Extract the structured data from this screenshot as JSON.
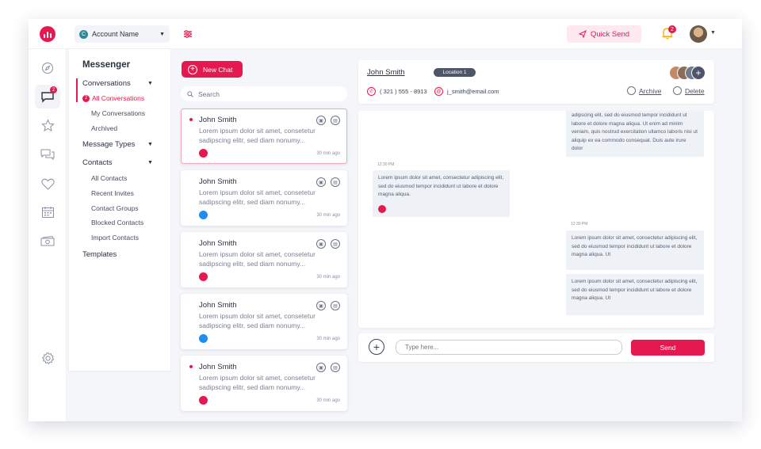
{
  "colors": {
    "brand": "#e5194f",
    "messenger": "#1f8ef1",
    "location_badge": "#4d5668"
  },
  "topbar": {
    "account_initial": "C",
    "account_name": "Account Name",
    "quick_send_label": "Quick Send",
    "notification_count": "2"
  },
  "rail": {
    "icons": [
      "compass-icon",
      "chat-icon",
      "star-icon",
      "comments-icon",
      "heart-icon",
      "calendar-icon",
      "money-icon",
      "settings-icon"
    ],
    "chat_badge": "2"
  },
  "nav": {
    "title": "Messenger",
    "conversations": "Conversations",
    "all_conversations": "All Conversations",
    "all_conversations_badge": "2",
    "my_conversations": "My Conversations",
    "archived": "Archived",
    "message_types": "Message Types",
    "contacts": "Contacts",
    "all_contacts": "All Contacts",
    "recent_invites": "Recent Invites",
    "contact_groups": "Contact Groups",
    "blocked_contacts": "Blocked Contacts",
    "import_contacts": "Import Contacts",
    "templates": "Templates"
  },
  "list": {
    "new_chat_label": "New Chat",
    "search_placeholder": "Search",
    "cards": [
      {
        "name": "John Smith",
        "preview": "Lorem ipsum dolor sit amet, consetetur sadipscing elitr, sed diam nonumy...",
        "time": "30 min ago",
        "channel": "sms",
        "unread": true,
        "active": true
      },
      {
        "name": "John Smith",
        "preview": "Lorem ipsum dolor sit amet, consetetur sadipscing elitr, sed diam nonumy...",
        "time": "30 min ago",
        "channel": "messenger",
        "unread": false,
        "active": false
      },
      {
        "name": "John Smith",
        "preview": "Lorem ipsum dolor sit amet, consetetur sadipscing elitr, sed diam nonumy...",
        "time": "30 min ago",
        "channel": "sms",
        "unread": false,
        "active": false
      },
      {
        "name": "John Smith",
        "preview": "Lorem ipsum dolor sit amet, consetetur sadipscing elitr, sed diam nonumy...",
        "time": "30 min ago",
        "channel": "messenger",
        "unread": false,
        "active": false
      },
      {
        "name": "John Smith",
        "preview": "Lorem ipsum dolor sit amet, consetetur sadipscing elitr, sed diam nonumy...",
        "time": "30 min ago",
        "channel": "sms",
        "unread": true,
        "active": false
      }
    ]
  },
  "chat": {
    "contact_name": "John Smith",
    "location": "Location 1",
    "phone": "( 321 ) 555 - 8913",
    "email": "j_smith@email.com",
    "archive_label": "Archive",
    "delete_label": "Delete",
    "messages": {
      "out_top": "adipscing elit, sed do eiusmod tempor incididunt ut labore et dolore magna aliqua. Ut enim ad minim veniam, quis nostrud exercitation ullamco laboris nisi ut aliquip ex ea commodo consequat. Duis aute irure dolor",
      "in_time": "12:30 PM",
      "in_text": "Lorem ipsum dolor sit amet, consectetur adipiscing elit, sed do eiusmod tempor incididunt ut labore et dolore magna aliqua.",
      "out_time": "12:30 PM",
      "out_1": "Lorem ipsum dolor sit amet, consectetur adipiscing elit, sed do eiusmod tempor incididunt ut labore et dolore magna aliqua. Ut",
      "out_2": "Lorem ipsum dolor sit amet, consectetur adipiscing elit, sed do eiusmod tempor incididunt ut labore et dolore magna aliqua. Ut"
    },
    "input_placeholder": "Type here...",
    "send_label": "Send"
  }
}
